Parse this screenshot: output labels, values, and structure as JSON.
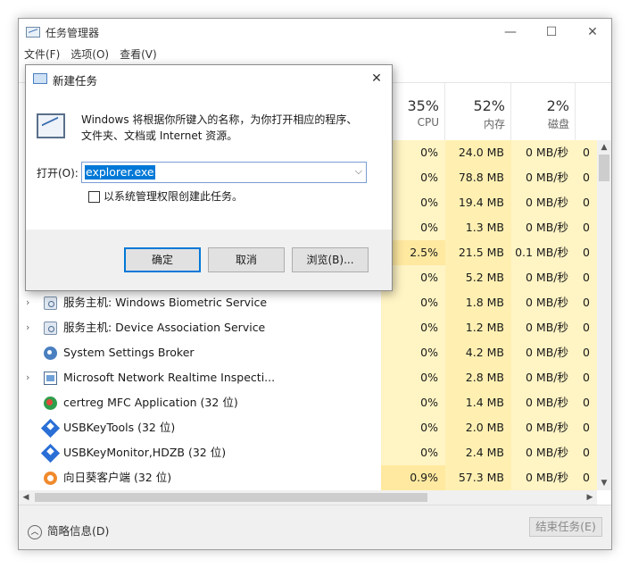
{
  "window": {
    "title": "任务管理器",
    "minimize_glyph": "—",
    "maximize_glyph": "☐",
    "close_glyph": "✕"
  },
  "menu": [
    "文件(F)",
    "选项(O)",
    "查看(V)"
  ],
  "columns": {
    "cpu": {
      "pct": "35%",
      "label": "CPU"
    },
    "memory": {
      "pct": "52%",
      "label": "内存"
    },
    "disk": {
      "pct": "2%",
      "label": "磁盘"
    }
  },
  "rows": [
    {
      "name": "",
      "icon": "",
      "expand": false,
      "cpu": "0%",
      "mem": "24.0 MB",
      "disk": "0 MB/秒",
      "net": "0"
    },
    {
      "name": "",
      "icon": "",
      "expand": false,
      "cpu": "0%",
      "mem": "78.8 MB",
      "disk": "0 MB/秒",
      "net": "0"
    },
    {
      "name": "",
      "icon": "",
      "expand": false,
      "cpu": "0%",
      "mem": "19.4 MB",
      "disk": "0 MB/秒",
      "net": "0"
    },
    {
      "name": "",
      "icon": "",
      "expand": false,
      "cpu": "0%",
      "mem": "1.3 MB",
      "disk": "0 MB/秒",
      "net": "0"
    },
    {
      "name": "",
      "icon": "",
      "expand": false,
      "cpu": "2.5%",
      "mem": "21.5 MB",
      "disk": "0.1 MB/秒",
      "net": "0"
    },
    {
      "name": "",
      "icon": "",
      "expand": false,
      "cpu": "0%",
      "mem": "5.2 MB",
      "disk": "0 MB/秒",
      "net": "0"
    },
    {
      "name": "服务主机: Windows Biometric Service",
      "icon": "gear-icon",
      "expand": true,
      "cpu": "0%",
      "mem": "1.8 MB",
      "disk": "0 MB/秒",
      "net": "0"
    },
    {
      "name": "服务主机: Device Association Service",
      "icon": "gear-icon",
      "expand": true,
      "cpu": "0%",
      "mem": "1.2 MB",
      "disk": "0 MB/秒",
      "net": "0"
    },
    {
      "name": "System Settings Broker",
      "icon": "settings-icon",
      "expand": false,
      "cpu": "0%",
      "mem": "4.2 MB",
      "disk": "0 MB/秒",
      "net": "0"
    },
    {
      "name": "Microsoft Network Realtime Inspecti...",
      "icon": "network-inspection-icon",
      "expand": true,
      "cpu": "0%",
      "mem": "2.8 MB",
      "disk": "0 MB/秒",
      "net": "0"
    },
    {
      "name": "certreg MFC Application (32 位)",
      "icon": "certreg-icon",
      "expand": false,
      "cpu": "0%",
      "mem": "1.4 MB",
      "disk": "0 MB/秒",
      "net": "0"
    },
    {
      "name": "USBKeyTools (32 位)",
      "icon": "usbkey-icon",
      "expand": false,
      "cpu": "0%",
      "mem": "2.0 MB",
      "disk": "0 MB/秒",
      "net": "0"
    },
    {
      "name": "USBKeyMonitor,HDZB (32 位)",
      "icon": "usbkey-icon",
      "expand": false,
      "cpu": "0%",
      "mem": "2.4 MB",
      "disk": "0 MB/秒",
      "net": "0"
    },
    {
      "name": "向日葵客户端 (32 位)",
      "icon": "sunflower-icon",
      "expand": false,
      "cpu": "0.9%",
      "mem": "57.3 MB",
      "disk": "0 MB/秒",
      "net": "0"
    }
  ],
  "footer": {
    "toggle_label": "简略信息(D)",
    "end_task_label": "结束任务(E)"
  },
  "dialog": {
    "title": "新建任务",
    "close_glyph": "✕",
    "description": "Windows 将根据你所键入的名称，为你打开相应的程序、文件夹、文档或 Internet 资源。",
    "open_label": "打开(O):",
    "input_value": "explorer.exe",
    "checkbox_label": "以系统管理权限创建此任务。",
    "checkbox_checked": false,
    "ok_label": "确定",
    "cancel_label": "取消",
    "browse_label": "浏览(B)..."
  },
  "colors": {
    "cpu_bg": "#fff4c4",
    "mem_bg": "#fff0b2",
    "disk_bg": "#fff4c4",
    "cpu_hot_bg": "#ffe9a0",
    "selection": "#0078d7"
  }
}
